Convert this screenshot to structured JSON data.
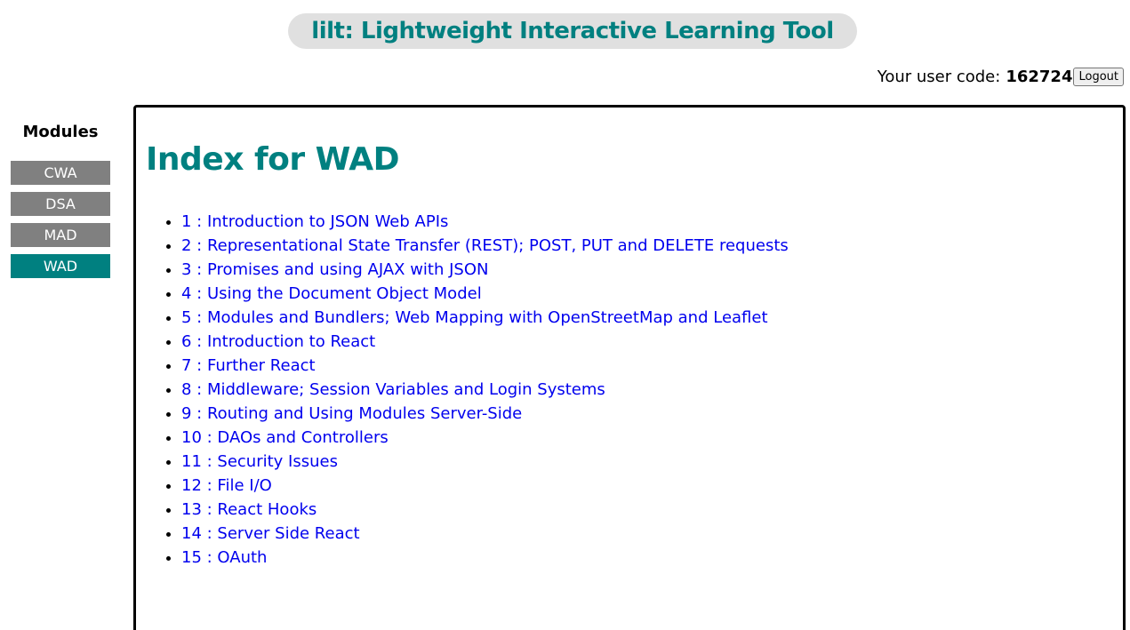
{
  "header": {
    "title": "lilt: Lightweight Interactive Learning Tool"
  },
  "user": {
    "label": "Your user code:",
    "code": "162724",
    "logout_label": "Logout"
  },
  "sidebar": {
    "title": "Modules",
    "items": [
      {
        "label": "CWA",
        "active": false
      },
      {
        "label": "DSA",
        "active": false
      },
      {
        "label": "MAD",
        "active": false
      },
      {
        "label": "WAD",
        "active": true
      }
    ]
  },
  "main": {
    "title": "Index for WAD",
    "lectures": [
      "1 : Introduction to JSON Web APIs",
      "2 : Representational State Transfer (REST); POST, PUT and DELETE requests",
      "3 : Promises and using AJAX with JSON",
      "4 : Using the Document Object Model",
      "5 : Modules and Bundlers; Web Mapping with OpenStreetMap and Leaflet",
      "6 : Introduction to React",
      "7 : Further React",
      "8 : Middleware; Session Variables and Login Systems",
      "9 : Routing and Using Modules Server-Side",
      "10 : DAOs and Controllers",
      "11 : Security Issues",
      "12 : File I/O",
      "13 : React Hooks",
      "14 : Server Side React",
      "15 : OAuth"
    ]
  },
  "colors": {
    "accent": "#008080",
    "inactive_module": "#808080",
    "link": "#0000ee"
  }
}
